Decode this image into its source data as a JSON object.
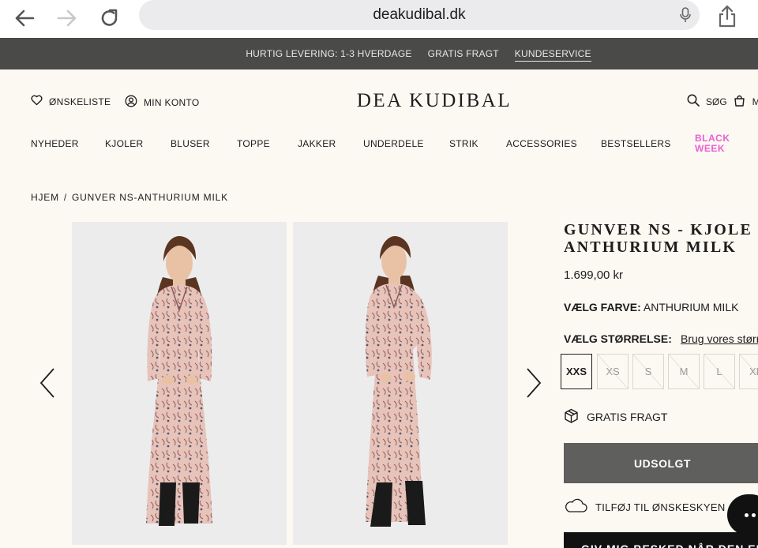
{
  "browser": {
    "url": "deakudibal.dk"
  },
  "promo": {
    "items": [
      "HURTIG LEVERING: 1-3 HVERDAGE",
      "GRATIS FRAGT",
      "KUNDESERVICE"
    ]
  },
  "header": {
    "wishlist_label": "ØNSKELISTE",
    "account_label": "MIN KONTO",
    "logo": "DEA KUDIBAL",
    "search_label": "SØG",
    "cart_label": "M"
  },
  "nav": {
    "items": [
      "NYHEDER",
      "KJOLER",
      "BLUSER",
      "TOPPE",
      "JAKKER",
      "UNDERDELE",
      "STRIK",
      "ACCESSORIES",
      "BESTSELLERS"
    ],
    "promo_line1": "BLACK",
    "promo_line2": "WEEK",
    "promo_color": "#ec5fd8"
  },
  "breadcrumb": {
    "home": "HJEM",
    "separator": "/",
    "current": "GUNVER NS-ANTHURIUM MILK"
  },
  "product": {
    "title": "GUNVER NS - KJOLE -\nANTHURIUM MILK",
    "price": "1.699,00 kr",
    "colour_label": "VÆLG FARVE:",
    "colour_value": "ANTHURIUM MILK",
    "size_label": "VÆLG STØRRELSE:",
    "size_guide": "Brug vores størr",
    "sizes": [
      "XXS",
      "XS",
      "S",
      "M",
      "L",
      "XL"
    ],
    "shipping_label": "GRATIS FRAGT",
    "soldout_label": "UDSOLGT",
    "wishlist_label": "TILFØJ TIL ØNSKESKYEN",
    "notify_label": "GIV MIG BESKED NÅR DEN ER"
  },
  "colors": {
    "promo_bar": "#4a4a48",
    "background": "#fcf9f2",
    "soldout_button": "#5f5f5d",
    "dress_pink": "#e7c3ba"
  }
}
